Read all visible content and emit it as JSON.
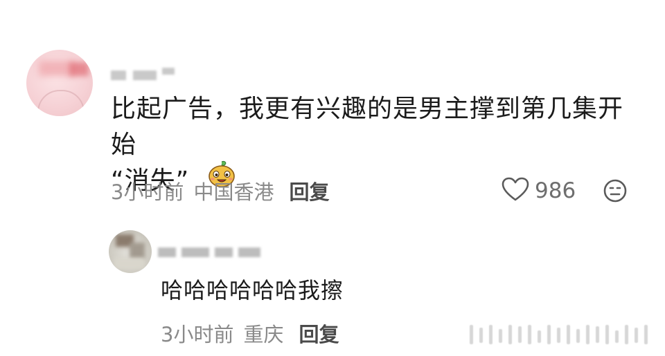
{
  "comment": {
    "text_line1": "比起广告，我更有兴趣的是男主撑到第几集开始",
    "text_line2": "“消失”",
    "time": "3小时前",
    "location": "中国香港",
    "reply_label": "回复",
    "like_count": "986",
    "icons": {
      "like": "heart-outline-icon",
      "dislike": "meh-face-icon",
      "sticker": "smiling-potato-sticker-icon"
    }
  },
  "reply": {
    "text": "哈哈哈哈哈哈我擦",
    "time": "3小时前",
    "location": "重庆",
    "reply_label": "回复"
  },
  "colors": {
    "text": "#1b1b1b",
    "meta": "#8a8a8a",
    "reply_button": "#4a4a4a",
    "icon": "#5a5a5a"
  }
}
